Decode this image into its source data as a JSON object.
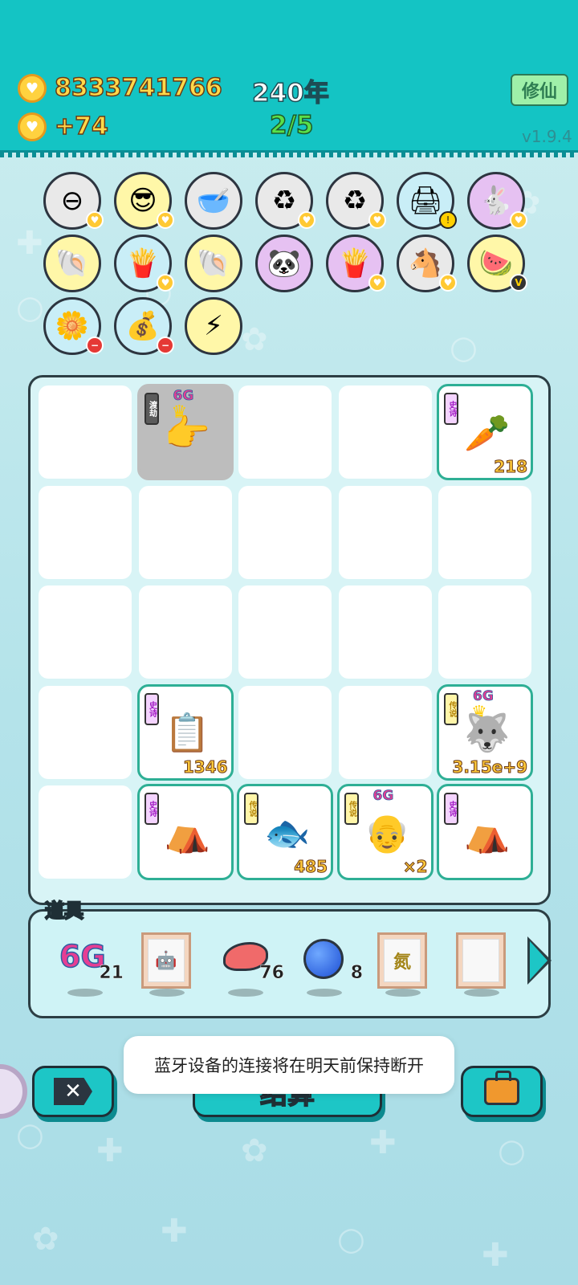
{
  "header": {
    "coins": "8333741766",
    "coin_rate": "+74",
    "year": "240年",
    "progress": "2/5",
    "xiuxian_button": "修仙",
    "version": "v1.9.4"
  },
  "skills": [
    {
      "icon": "no-entry-icon",
      "glyph": "⊖",
      "bg": "#e9e9e9",
      "badge": "heart"
    },
    {
      "icon": "sunglasses-icon",
      "glyph": "😎",
      "bg": "#fff7a8",
      "badge": "heart"
    },
    {
      "icon": "dog-bowl-icon",
      "glyph": "🥣",
      "bg": "#e9e9e9",
      "badge": ""
    },
    {
      "icon": "recycle-icon",
      "glyph": "♻",
      "bg": "#e9e9e9",
      "badge": "heart"
    },
    {
      "icon": "recycle-icon",
      "glyph": "♻",
      "bg": "#e9e9e9",
      "badge": "heart"
    },
    {
      "icon": "printer-icon",
      "glyph": "🖨",
      "bg": "#c9eef7",
      "badge": "warn"
    },
    {
      "icon": "rabbit-icon",
      "glyph": "🐇",
      "bg": "#e6c1f2",
      "badge": "heart"
    },
    {
      "icon": "shell-icon",
      "glyph": "🐚",
      "bg": "#fff7a8",
      "badge": ""
    },
    {
      "icon": "fries-icon",
      "glyph": "🍟",
      "bg": "#c9eef7",
      "badge": "heart"
    },
    {
      "icon": "shell-icon",
      "glyph": "🐚",
      "bg": "#fff7a8",
      "badge": ""
    },
    {
      "icon": "panda-icon",
      "glyph": "🐼",
      "bg": "#e6c1f2",
      "badge": ""
    },
    {
      "icon": "fries-icon",
      "glyph": "🍟",
      "bg": "#e6c1f2",
      "badge": "heart"
    },
    {
      "icon": "horses-icon",
      "glyph": "🐴",
      "bg": "#e9e9e9",
      "badge": "heart"
    },
    {
      "icon": "fruit-basket-icon",
      "glyph": "🍉",
      "bg": "#fff7a8",
      "badge": "v"
    },
    {
      "icon": "flower-pot-icon",
      "glyph": "🌼",
      "bg": "#c9eef7",
      "badge": "minus"
    },
    {
      "icon": "money-bag-icon",
      "glyph": "💰",
      "bg": "#c9eef7",
      "badge": "minus"
    },
    {
      "icon": "lightning-icon",
      "glyph": "⚡",
      "bg": "#fff7a8",
      "badge": ""
    }
  ],
  "board": {
    "cards": [
      {
        "slot": "r0c1",
        "tag": "渡劫",
        "tag_type": "dark",
        "sixg": "6G",
        "crown": true,
        "icon": "pointing-hand-icon",
        "glyph": "👉",
        "count": "",
        "gray": true
      },
      {
        "slot": "r0c4",
        "tag": "史诗",
        "tag_type": "epic",
        "sixg": "",
        "crown": false,
        "icon": "carrot-icon",
        "glyph": "🥕",
        "count": "218",
        "gray": false
      },
      {
        "slot": "r3c1",
        "tag": "史诗",
        "tag_type": "epic",
        "sixg": "",
        "crown": false,
        "icon": "copy-paste-icon",
        "glyph": "📋",
        "count": "1346",
        "gray": false
      },
      {
        "slot": "r3c4",
        "tag": "传说",
        "tag_type": "leg",
        "sixg": "6G",
        "crown": true,
        "icon": "husky-icon",
        "glyph": "🐺",
        "count": "3.15e+9",
        "gray": false
      },
      {
        "slot": "r4c1",
        "tag": "史诗",
        "tag_type": "epic",
        "sixg": "",
        "crown": false,
        "icon": "rabbit-tent-icon",
        "glyph": "⛺",
        "count": "",
        "gray": false
      },
      {
        "slot": "r4c2",
        "tag": "传说",
        "tag_type": "leg",
        "sixg": "",
        "crown": false,
        "icon": "koi-fish-icon",
        "glyph": "🐟",
        "count": "485",
        "gray": false
      },
      {
        "slot": "r4c3",
        "tag": "传说",
        "tag_type": "leg",
        "sixg": "6G",
        "crown": false,
        "icon": "bald-man-icon",
        "glyph": "👴",
        "count": "×2",
        "gray": false
      },
      {
        "slot": "r4c4",
        "tag": "史诗",
        "tag_type": "epic",
        "sixg": "",
        "crown": false,
        "icon": "rabbit-tent-icon",
        "glyph": "⛺",
        "count": "",
        "gray": false
      }
    ]
  },
  "props": {
    "title": "道具",
    "items": [
      {
        "icon": "6g-icon",
        "label": "6G",
        "count": "21"
      },
      {
        "icon": "robot-portrait-icon",
        "label": "",
        "count": ""
      },
      {
        "icon": "liver-icon",
        "label": "",
        "count": "76"
      },
      {
        "icon": "blueberry-icon",
        "label": "",
        "count": "8"
      },
      {
        "icon": "nitrogen-portrait-icon",
        "label": "氮",
        "count": ""
      },
      {
        "icon": "blank-portrait-icon",
        "label": "",
        "count": ""
      }
    ]
  },
  "buttons": {
    "settle": "结算"
  },
  "toast": "蓝牙设备的连接将在明天前保持断开"
}
